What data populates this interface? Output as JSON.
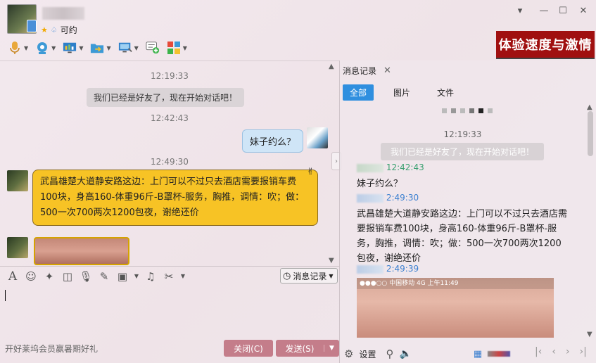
{
  "window": {
    "status": "可约",
    "controls": [
      "▾",
      "—",
      "☐",
      "✕"
    ]
  },
  "toolbar": {
    "items": [
      "mic",
      "camera",
      "screen-share",
      "file-transfer",
      "remote-desktop",
      "add-contact",
      "apps"
    ]
  },
  "ad": {
    "text": "体验速度与激情"
  },
  "chat": {
    "time1": "12:19:33",
    "system_msg": "我们已经是好友了，现在开始对话吧！",
    "time2": "12:42:43",
    "my_msg": "妹子约么？",
    "time3": "12:49:30",
    "peer_msg": "武昌雄楚大道静安路这边：上门可以不过只去酒店需要报销车费100块，身高160-体重96斤-B罩杯-服务，胸推，调情：吹；做：500一次700两次1200包夜，谢绝还价"
  },
  "input_toolbar": {
    "history_label": "消息记录"
  },
  "input": {
    "promo": "开好莱坞会员赢暑期好礼",
    "close_label": "关闭(C)",
    "send_label": "发送(S)"
  },
  "panel": {
    "tab_title": "消息记录",
    "filters": [
      "全部",
      "图片",
      "文件"
    ],
    "time1": "12:19:33",
    "system_msg": "我们已经是好友了，现在开始对话吧！",
    "entry1_time": "12:42:43",
    "entry1_text": "妹子约么？",
    "entry2_time": "2:49:30",
    "entry2_text": "武昌雄楚大道静安路这边：上门可以不过只去酒店需要报销车费100块，身高160-体重96斤-B罩杯-服务，胸推，调情：吹；做：500一次700两次1200包夜，谢绝还价",
    "entry3_time": "2:49:39",
    "img_status": "●●●○○ 中国移动 4G    上午11:49",
    "settings_label": "设置"
  },
  "colors": {
    "accent": "#2f8fdf",
    "bubble_in": "#f7c325",
    "bubble_out": "#cfe5f7",
    "button": "#c47d8a",
    "ad_bg": "#a01010"
  }
}
